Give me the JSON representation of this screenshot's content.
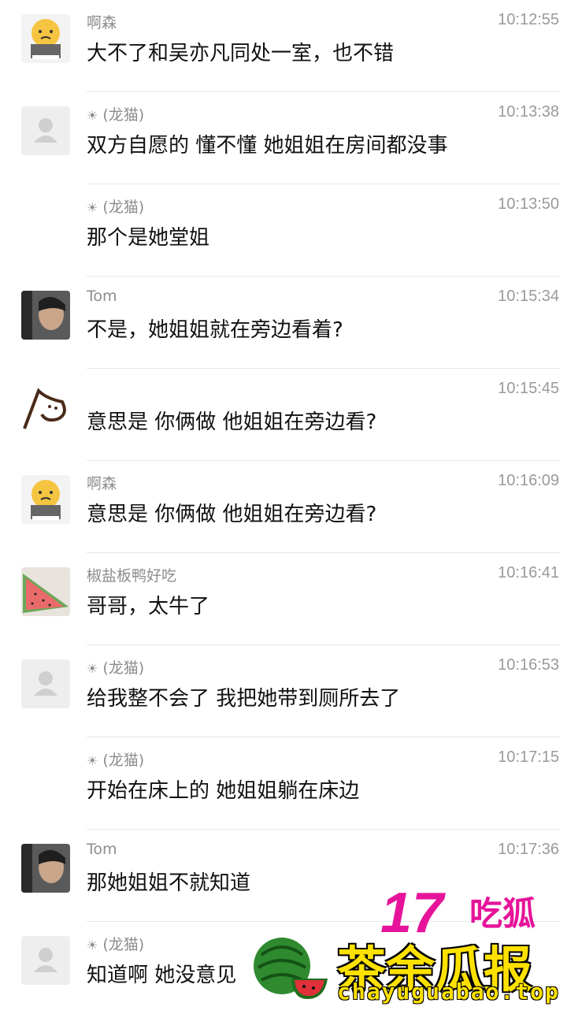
{
  "messages": [
    {
      "sender": "啊森",
      "time": "10:12:55",
      "text": "大不了和吴亦凡同处一室，也不错",
      "avatar": "emoji-avatar"
    },
    {
      "sender": "(龙猫)",
      "time": "10:13:38",
      "text": "双方自愿的 懂不懂 她姐姐在房间都没事",
      "avatar": "default-avatar",
      "prefix_icon": "sun-icon"
    },
    {
      "sender": "(龙猫)",
      "time": "10:13:50",
      "text": "那个是她堂姐",
      "avatar": "none",
      "prefix_icon": "sun-icon"
    },
    {
      "sender": "Tom",
      "time": "10:15:34",
      "text": "不是，她姐姐就在旁边看着?",
      "avatar": "photo-avatar"
    },
    {
      "sender": "",
      "time": "10:15:45",
      "text": "意思是 你俩做 他姐姐在旁边看?",
      "avatar": "drawing-avatar"
    },
    {
      "sender": "啊森",
      "time": "10:16:09",
      "text": "意思是 你俩做 他姐姐在旁边看?",
      "avatar": "emoji-avatar"
    },
    {
      "sender": "椒盐板鸭好吃",
      "time": "10:16:41",
      "text": "哥哥，太牛了",
      "avatar": "watermelon-avatar"
    },
    {
      "sender": "(龙猫)",
      "time": "10:16:53",
      "text": "给我整不会了 我把她带到厕所去了",
      "avatar": "default-avatar",
      "prefix_icon": "sun-icon"
    },
    {
      "sender": "(龙猫)",
      "time": "10:17:15",
      "text": "开始在床上的 她姐姐躺在床边",
      "avatar": "none",
      "prefix_icon": "sun-icon"
    },
    {
      "sender": "Tom",
      "time": "10:17:36",
      "text": "那她姐姐不就知道",
      "avatar": "photo-avatar"
    },
    {
      "sender": "(龙猫)",
      "time": "",
      "text": "知道啊 她没意见",
      "avatar": "default-avatar",
      "prefix_icon": "sun-icon"
    }
  ],
  "watermark": {
    "number": "17",
    "chi": "吃狐",
    "main": "茶余瓜报",
    "url": "chayuguabao.top"
  },
  "colors": {
    "sender": "#8c8c8c",
    "time": "#9a9a9a",
    "divider": "#e8e8e8",
    "watermark_pink": "#e6149a",
    "watermark_yellow": "#ffe100"
  }
}
